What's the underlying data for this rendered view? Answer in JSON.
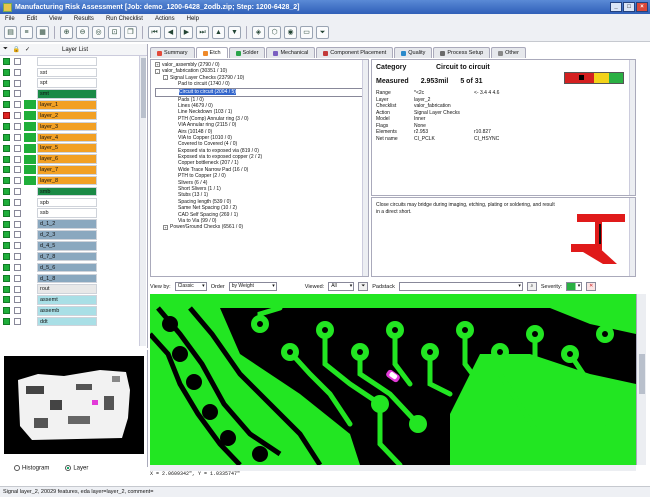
{
  "window": {
    "title": "Manufacturing Risk Assessment [Job: demo_1200-6428_2odb.zip; Step: 1200-6428_2]",
    "buttons": [
      "minimize",
      "maximize",
      "close"
    ]
  },
  "menu": [
    "File",
    "Edit",
    "View",
    "Results",
    "Run Checklist",
    "Actions",
    "Help"
  ],
  "toolbar": {
    "icons": [
      "open-icon",
      "list-icon",
      "grid-icon",
      "zoom-in-icon",
      "zoom-out-icon",
      "zoom-fit-icon",
      "zoom-area-icon",
      "copy-icon",
      "prev-first-icon",
      "prev-icon",
      "next-icon",
      "next-last-icon",
      "up-icon",
      "down-icon",
      "layer-icon",
      "3d-icon",
      "eye-icon",
      "view-icon",
      "filter-icon"
    ]
  },
  "layer_list": {
    "header": "Layer List",
    "rows": [
      {
        "name": "",
        "color": "#ffffff",
        "checked": true,
        "extra": false
      },
      {
        "name": "sst",
        "color": "#ffffff",
        "checked": true,
        "extra": false
      },
      {
        "name": "spt",
        "color": "#ffffff",
        "checked": true,
        "extra": false
      },
      {
        "name": "smt",
        "color": "#1a8a46",
        "checked": true,
        "extra": false
      },
      {
        "name": "layer_1",
        "color": "#f2a024",
        "checked": true,
        "extra": true
      },
      {
        "name": "layer_2",
        "color": "#f2a024",
        "checked": "red",
        "extra": true
      },
      {
        "name": "layer_3",
        "color": "#f2a024",
        "checked": true,
        "extra": true
      },
      {
        "name": "layer_4",
        "color": "#f2a024",
        "checked": true,
        "extra": true
      },
      {
        "name": "layer_5",
        "color": "#f2a024",
        "checked": true,
        "extra": true
      },
      {
        "name": "layer_6",
        "color": "#f2a024",
        "checked": true,
        "extra": true
      },
      {
        "name": "layer_7",
        "color": "#f2a024",
        "checked": true,
        "extra": true
      },
      {
        "name": "layer_8",
        "color": "#f2a024",
        "checked": true,
        "extra": true
      },
      {
        "name": "smb",
        "color": "#1a8a46",
        "checked": true,
        "extra": false
      },
      {
        "name": "spb",
        "color": "#ffffff",
        "checked": true,
        "extra": false
      },
      {
        "name": "ssb",
        "color": "#ffffff",
        "checked": true,
        "extra": false
      },
      {
        "name": "d_1_2",
        "color": "#8aa8bf",
        "checked": true,
        "extra": false
      },
      {
        "name": "d_2_3",
        "color": "#8aa8bf",
        "checked": true,
        "extra": false
      },
      {
        "name": "d_4_5",
        "color": "#8aa8bf",
        "checked": true,
        "extra": false
      },
      {
        "name": "d_7_8",
        "color": "#8aa8bf",
        "checked": true,
        "extra": false
      },
      {
        "name": "d_5_6",
        "color": "#8aa8bf",
        "checked": true,
        "extra": false
      },
      {
        "name": "d_1_8",
        "color": "#8aa8bf",
        "checked": true,
        "extra": false
      },
      {
        "name": "rout",
        "color": "#e8e8e8",
        "checked": true,
        "extra": false
      },
      {
        "name": "assemt",
        "color": "#a9dfe6",
        "checked": true,
        "extra": false
      },
      {
        "name": "assemb",
        "color": "#a9dfe6",
        "checked": true,
        "extra": false
      },
      {
        "name": "ddt",
        "color": "#a9dfe6",
        "checked": true,
        "extra": false
      }
    ]
  },
  "overview": {
    "radio_histogram": "Histogram",
    "radio_layer": "Layer",
    "selected": "Layer"
  },
  "tabs": [
    {
      "label": "Summary",
      "color": "#e24a3a",
      "active": false
    },
    {
      "label": "Etch",
      "color": "#ef8a2a",
      "active": true
    },
    {
      "label": "Solder",
      "color": "#2aa44a",
      "active": false
    },
    {
      "label": "Mechanical",
      "color": "#7b5fc1",
      "active": false
    },
    {
      "label": "Component Placement",
      "color": "#c23a3a",
      "active": false
    },
    {
      "label": "Quality",
      "color": "#2a8acb",
      "active": false
    },
    {
      "label": "Process Setup",
      "color": "#6a6a6a",
      "active": false
    },
    {
      "label": "Other",
      "color": "#888888",
      "active": false
    }
  ],
  "checks_tree": [
    {
      "label": "valor_assembly (2790 / 0)",
      "indent": 0,
      "expander": "+"
    },
    {
      "label": "valor_fabrication (30351 / 10)",
      "indent": 0,
      "expander": "-"
    },
    {
      "label": "Signal Layer Checks (23790 / 10)",
      "indent": 1,
      "expander": "-"
    },
    {
      "label": "Pad to circuit (1740 / 0)",
      "indent": 2
    },
    {
      "label": "Circuit to circuit (2004 / 5)",
      "indent": 2,
      "selected": true
    },
    {
      "label": "Pads (1 / 0)",
      "indent": 2
    },
    {
      "label": "Lines (4679 / 0)",
      "indent": 2
    },
    {
      "label": "Line Neckdown (103 / 1)",
      "indent": 2
    },
    {
      "label": "PTH (Comp) Annular ring (3 / 0)",
      "indent": 2
    },
    {
      "label": "VIA Annular ring (2115 / 0)",
      "indent": 2
    },
    {
      "label": "Airs (10148 / 0)",
      "indent": 2
    },
    {
      "label": "VIA to Copper (1010 / 0)",
      "indent": 2
    },
    {
      "label": "Covered to Covered (4 / 0)",
      "indent": 2
    },
    {
      "label": "Exposed via to exposed via (819 / 0)",
      "indent": 2
    },
    {
      "label": "Exposed via to exposed copper (2 / 2)",
      "indent": 2
    },
    {
      "label": "Copper bottleneck (207 / 1)",
      "indent": 2
    },
    {
      "label": "Wide Trace Narrow Pad (16 / 0)",
      "indent": 2
    },
    {
      "label": "PTH to Copper (2 / 0)",
      "indent": 2
    },
    {
      "label": "Slivers (6 / 4)",
      "indent": 2
    },
    {
      "label": "Short Slivers (1 / 1)",
      "indent": 2
    },
    {
      "label": "Stubs (13 / 1)",
      "indent": 2
    },
    {
      "label": "Spacing length (539 / 0)",
      "indent": 2
    },
    {
      "label": "Same Net Spacing (10 / 2)",
      "indent": 2
    },
    {
      "label": "CAD Self Spacing (269 / 1)",
      "indent": 2
    },
    {
      "label": "Via to Via (99 / 0)",
      "indent": 2
    },
    {
      "label": "Power/Ground Checks (6561 / 0)",
      "indent": 1,
      "expander": "+"
    }
  ],
  "details": {
    "category_label": "Category",
    "category_value": "Circuit to circuit",
    "measured_label": "Measured",
    "measured_value": "2.953mil",
    "measured_count": "5 of 31",
    "rows": [
      {
        "k": "Range",
        "v": "*<2c",
        "v2": "<- 3.4 4 4.6"
      },
      {
        "k": "Layer",
        "v": "layer_2",
        "v2": ""
      },
      {
        "k": "Checklist",
        "v": "valor_fabrication",
        "v2": ""
      },
      {
        "k": "Action",
        "v": "Signal Layer Checks",
        "v2": ""
      },
      {
        "k": "Model",
        "v": "Inner",
        "v2": ""
      },
      {
        "k": "Flags",
        "v": "None",
        "v2": ""
      },
      {
        "k": "",
        "v": "",
        "v2": ""
      },
      {
        "k": "Elements",
        "v": "r2.953",
        "v2": "r10.827"
      },
      {
        "k": "Net name",
        "v": "CI_PCLK",
        "v2": "CI_HSYNC"
      }
    ],
    "severity_colors": [
      "#d42020",
      "#d42020",
      "#f2d21a",
      "#2ab043"
    ]
  },
  "description": {
    "text": "Close circuits may bridge during imaging, etching, plating or soldering, and result in a direct short."
  },
  "filterbar": {
    "view_by_label": "View by:",
    "view_by_value": "Classic",
    "order_label": "Order",
    "order_value": "by Weight",
    "viewed_label": "Viewed:",
    "viewed_value": "All",
    "padstack_label": "Padstack",
    "severity_label": "Severity:"
  },
  "board": {
    "coords": "X = 2.0609342\", Y = 1.0335747\""
  },
  "status": {
    "text": "Signal layer_2, 20029 features, eda layer=layer_2, comment="
  }
}
